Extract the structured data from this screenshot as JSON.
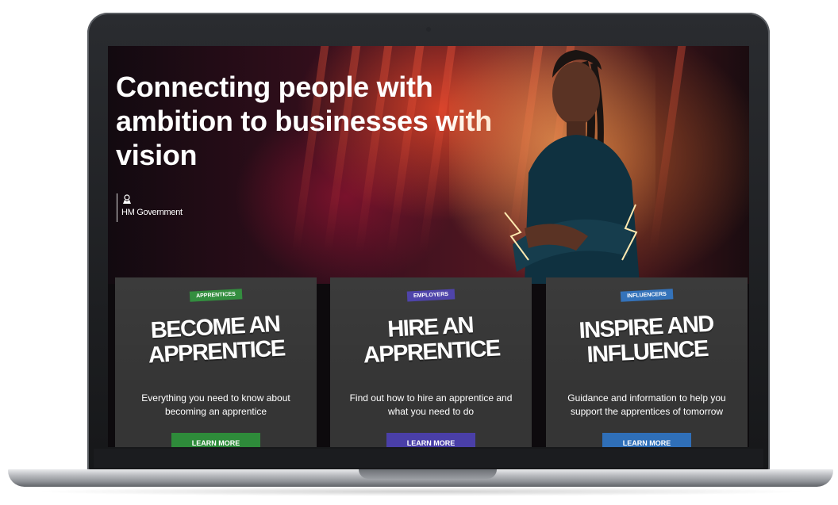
{
  "hero": {
    "title": "Connecting people with ambition to businesses with vision",
    "government_label": "HM Government"
  },
  "cards": [
    {
      "badge": "APPRENTICES",
      "badge_color": "#2e8b3a",
      "title": "BECOME AN APPRENTICE",
      "description": "Everything you need to know about becoming an apprentice",
      "button_label": "LEARN MORE",
      "button_color": "#2e8b3a"
    },
    {
      "badge": "EMPLOYERS",
      "badge_color": "#4a3fa8",
      "title": "HIRE AN APPRENTICE",
      "description": "Find out how to hire an apprentice and what you need to do",
      "button_label": "LEARN MORE",
      "button_color": "#4a3fa8"
    },
    {
      "badge": "INFLUENCERS",
      "badge_color": "#2f6fb8",
      "title": "INSPIRE AND INFLUENCE",
      "description": "Guidance and information to help you support the apprentices of tomorrow",
      "button_label": "LEARN MORE",
      "button_color": "#2f6fb8"
    }
  ]
}
